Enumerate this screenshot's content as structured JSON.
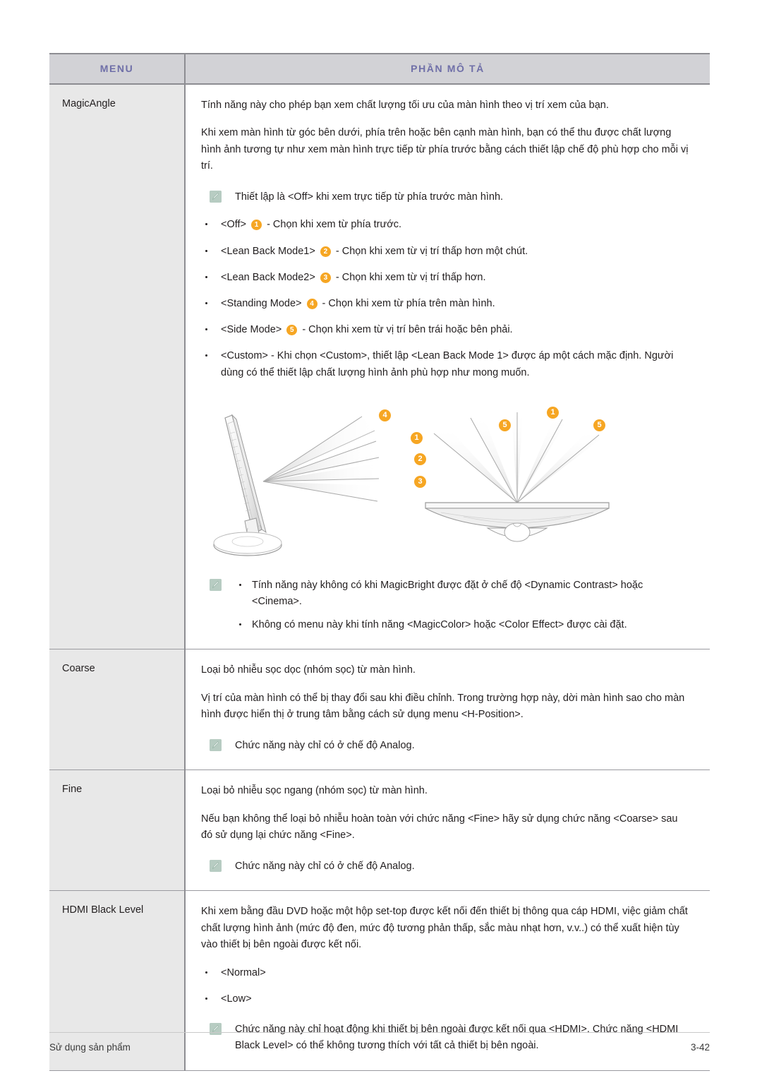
{
  "table": {
    "headers": {
      "menu": "MENU",
      "description": "PHẦN MÔ TẢ"
    },
    "accent_header_text_color": "#6f6fa8",
    "header_bg_color": "#d2d2d6",
    "menu_cell_bg_color": "#e8e8e8",
    "badge_color": "#f6a623",
    "note_icon_color": "#b7ccc2",
    "rows": [
      {
        "menu": "MagicAngle",
        "paragraphs": [
          "Tính năng này cho phép bạn xem chất lượng tối ưu của màn hình theo vị trí xem của bạn.",
          "Khi xem màn hình từ góc bên dưới, phía trên hoặc bên cạnh màn hình, bạn có thể thu được chất lượng hình ảnh tương tự như xem màn hình trực tiếp từ phía trước bằng cách thiết lập chế độ phù hợp cho mỗi vị trí."
        ],
        "note_top": "Thiết lập là <Off> khi xem trực tiếp từ phía trước màn hình.",
        "options": [
          {
            "label": "<Off>",
            "badge": "1",
            "desc": "- Chọn khi xem từ phía trước."
          },
          {
            "label": "<Lean Back Mode1>",
            "badge": "2",
            "desc": "- Chọn khi xem từ vị trí thấp hơn một chút."
          },
          {
            "label": "<Lean Back Mode2>",
            "badge": "3",
            "desc": "- Chọn khi xem từ vị trí thấp hơn."
          },
          {
            "label": "<Standing Mode>",
            "badge": "4",
            "desc": "- Chọn khi xem từ phía trên màn hình."
          },
          {
            "label": "<Side Mode>",
            "badge": "5",
            "desc": "- Chọn khi xem từ vị trí bên trái hoặc bên phải."
          },
          {
            "label": "<Custom>",
            "badge": "",
            "desc": "- Khi chọn <Custom>, thiết lập <Lean Back Mode 1> được áp một cách mặc định. Người dùng có thể thiết lập chất lượng hình ảnh phù hợp như mong muốn."
          }
        ],
        "figure": {
          "caption": "",
          "side_view_badges": [
            "4",
            "1",
            "2",
            "3"
          ],
          "top_view_badges": [
            "5",
            "1",
            "5"
          ]
        },
        "note_bullets": [
          "Tính năng này không có khi MagicBright được đặt ở chế độ <Dynamic Contrast> hoặc <Cinema>.",
          "Không có menu này khi tính năng <MagicColor> hoặc <Color Effect> được cài đặt."
        ]
      },
      {
        "menu": "Coarse",
        "paragraphs": [
          "Loại bỏ nhiễu sọc dọc (nhóm sọc) từ màn hình.",
          "Vị trí của màn hình có thể bị thay đổi sau khi điều chỉnh. Trong trường hợp này, dời màn hình sao cho màn hình được hiển thị ở trung tâm bằng cách sử dụng menu <H-Position>."
        ],
        "note": "Chức năng này chỉ có ở chế độ Analog."
      },
      {
        "menu": "Fine",
        "paragraphs": [
          "Loại bỏ nhiễu sọc ngang (nhóm sọc) từ màn hình.",
          "Nếu bạn không thể loại bỏ nhiễu hoàn toàn với chức năng <Fine> hãy sử dụng chức năng <Coarse> sau đó sử dụng lại chức năng <Fine>."
        ],
        "note": "Chức năng này chỉ có ở chế độ Analog."
      },
      {
        "menu": "HDMI Black Level",
        "paragraphs": [
          "Khi xem bằng đầu DVD hoặc một hộp set-top được kết nối đến thiết bị thông qua cáp HDMI, việc giảm chất chất lượng hình ảnh (mức độ đen, mức độ tương phản thấp, sắc màu nhạt hơn, v.v..) có thể xuất hiện tùy vào thiết bị bên ngoài được kết nối."
        ],
        "options": [
          {
            "label": "<Normal>",
            "badge": "",
            "desc": ""
          },
          {
            "label": "<Low>",
            "badge": "",
            "desc": ""
          }
        ],
        "note": "Chức năng này chỉ hoạt động khi thiết bị bên ngoài được kết nối qua <HDMI>. Chức năng <HDMI Black Level> có thể không tương thích với tất cả thiết bị bên ngoài."
      }
    ]
  },
  "footer": {
    "left": "Sử dụng sản phẩm",
    "page_number": "3-42"
  }
}
